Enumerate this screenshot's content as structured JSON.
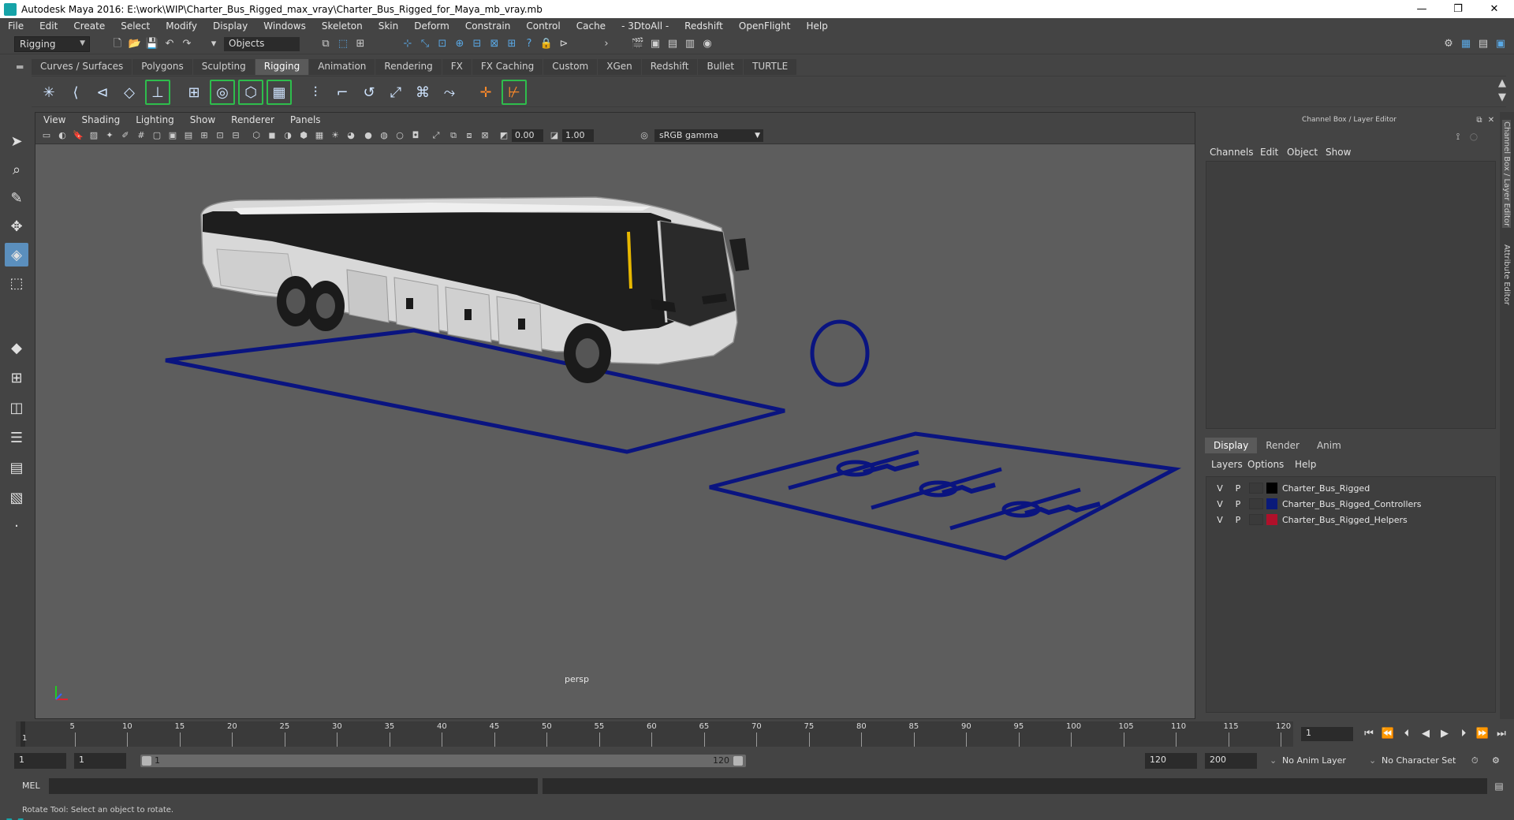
{
  "window": {
    "title": "Autodesk Maya 2016: E:\\work\\WIP\\Charter_Bus_Rigged_max_vray\\Charter_Bus_Rigged_for_Maya_mb_vray.mb",
    "minimize": "—",
    "maximize": "❐",
    "close": "✕"
  },
  "menubar": [
    "File",
    "Edit",
    "Create",
    "Select",
    "Modify",
    "Display",
    "Windows",
    "Skeleton",
    "Skin",
    "Deform",
    "Constrain",
    "Control",
    "Cache",
    "- 3DtoAll -",
    "Redshift",
    "OpenFlight",
    "Help"
  ],
  "statusline": {
    "mode": "Rigging",
    "objects_field": "Objects"
  },
  "shelf": {
    "tabs": [
      "Curves / Surfaces",
      "Polygons",
      "Sculpting",
      "Rigging",
      "Animation",
      "Rendering",
      "FX",
      "FX Caching",
      "Custom",
      "XGen",
      "Redshift",
      "Bullet",
      "TURTLE"
    ],
    "active_tab": "Rigging",
    "icons": [
      "joint-tool-icon",
      "ik-handle-icon",
      "ik-spline-icon",
      "insert-joint-icon",
      "locator-icon",
      "bind-skin-icon",
      "smooth-bind-icon",
      "interactive-bind-icon",
      "cluster-icon",
      "lattice-icon",
      "wire-icon",
      "point-constraint-icon",
      "orient-constraint-icon",
      "parent-constraint-icon",
      "aim-constraint-icon",
      "pole-vector-icon",
      "skin-weights-icon",
      "quick-rig-icon",
      "hik-icon"
    ]
  },
  "viewport": {
    "menus": [
      "View",
      "Shading",
      "Lighting",
      "Show",
      "Renderer",
      "Panels"
    ],
    "exposure": "0.00",
    "gamma": "1.00",
    "color_space": "sRGB gamma",
    "camera": "persp"
  },
  "channel_box": {
    "header": "Channel Box / Layer Editor",
    "menus": [
      "Channels",
      "Edit",
      "Object",
      "Show"
    ]
  },
  "layer_editor": {
    "tabs": [
      "Display",
      "Render",
      "Anim"
    ],
    "active_tab": "Display",
    "menus": [
      "Layers",
      "Options",
      "Help"
    ],
    "layers": [
      {
        "v": "V",
        "p": "P",
        "name": "Charter_Bus_Rigged",
        "color": "#000000"
      },
      {
        "v": "V",
        "p": "P",
        "name": "Charter_Bus_Rigged_Controllers",
        "color": "#0a1a7a"
      },
      {
        "v": "V",
        "p": "P",
        "name": "Charter_Bus_Rigged_Helpers",
        "color": "#b0102a"
      }
    ]
  },
  "side_tabs": [
    "Channel Box / Layer Editor",
    "Attribute Editor"
  ],
  "timeslider": {
    "ticks": [
      "5",
      "10",
      "15",
      "20",
      "25",
      "30",
      "35",
      "40",
      "45",
      "50",
      "55",
      "60",
      "65",
      "70",
      "75",
      "80",
      "85",
      "90",
      "95",
      "100",
      "105",
      "110",
      "115",
      "120"
    ],
    "current_frame_label": "1",
    "current_frame": "1"
  },
  "rangebar": {
    "start": "1",
    "playback_start": "1",
    "slider_start": "1",
    "slider_end": "120",
    "playback_end": "120",
    "end": "200",
    "anim_layer": "No Anim Layer",
    "character_set": "No Character Set"
  },
  "cmdline": {
    "label": "MEL"
  },
  "helpline": {
    "text": "Rotate Tool: Select an object to rotate."
  },
  "colors": {
    "controller_blue": "#0a1480",
    "bus_body": "#dcdcdc",
    "viewport_bg": "#5d5d5d",
    "active_tool": "#5b8fbd"
  }
}
